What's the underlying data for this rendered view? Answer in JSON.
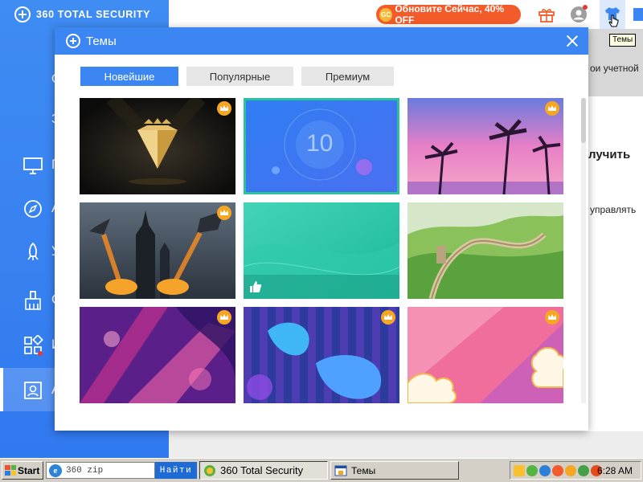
{
  "app": {
    "logo_text": "360 TOTAL SECURITY",
    "sidebar": {
      "items": [
        {
          "label": "П",
          "icon": "monitor-icon"
        },
        {
          "label": "А",
          "icon": "compass-icon"
        },
        {
          "label": "У",
          "icon": "rocket-icon"
        },
        {
          "label": "О",
          "icon": "broom-icon"
        },
        {
          "label": "И",
          "icon": "tools-grid-icon"
        },
        {
          "label": "А",
          "icon": "account-icon",
          "active": true
        }
      ],
      "partial_labels": [
        "О",
        "З"
      ]
    },
    "topbar": {
      "upgrade_coin": "GC",
      "upgrade_label": "Обновите Сейчас, 40% OFF",
      "themes_tooltip": "Темы"
    },
    "behind_text": {
      "account_frag": "ои учетной",
      "improve_frag": "лучить",
      "manage_frag": "управлять"
    },
    "colors": {
      "brand_blue": "#3b86f2",
      "selected_border": "#2cc39a",
      "premium_badge": "#f5a623",
      "upgrade_red": "#f35b2a"
    }
  },
  "dialog": {
    "title": "Темы",
    "tabs": [
      {
        "label": "Новейшие",
        "active": true
      },
      {
        "label": "Популярные",
        "active": false
      },
      {
        "label": "Премиум",
        "active": false
      }
    ],
    "themes": [
      {
        "name": "diamond-dark",
        "premium": true,
        "selected": false
      },
      {
        "name": "windows-10-blue",
        "premium": false,
        "selected": true,
        "text": "10"
      },
      {
        "name": "palm-sunset",
        "premium": true,
        "selected": false
      },
      {
        "name": "dragon-castle",
        "premium": true,
        "selected": false
      },
      {
        "name": "teal-waves",
        "premium": false,
        "selected": false,
        "liked": true
      },
      {
        "name": "great-wall",
        "premium": false,
        "selected": false
      },
      {
        "name": "purple-floral",
        "premium": true,
        "selected": false
      },
      {
        "name": "blue-blobs",
        "premium": true,
        "selected": false
      },
      {
        "name": "pink-clouds",
        "premium": true,
        "selected": false
      }
    ]
  },
  "taskbar": {
    "start_label": "Start",
    "address_value": "360 zip",
    "find_label": "Найти",
    "tasks": [
      {
        "label": "360 Total Security",
        "pressed": true
      },
      {
        "label": "Темы",
        "pressed": false
      }
    ],
    "clock": "6:28 AM"
  }
}
